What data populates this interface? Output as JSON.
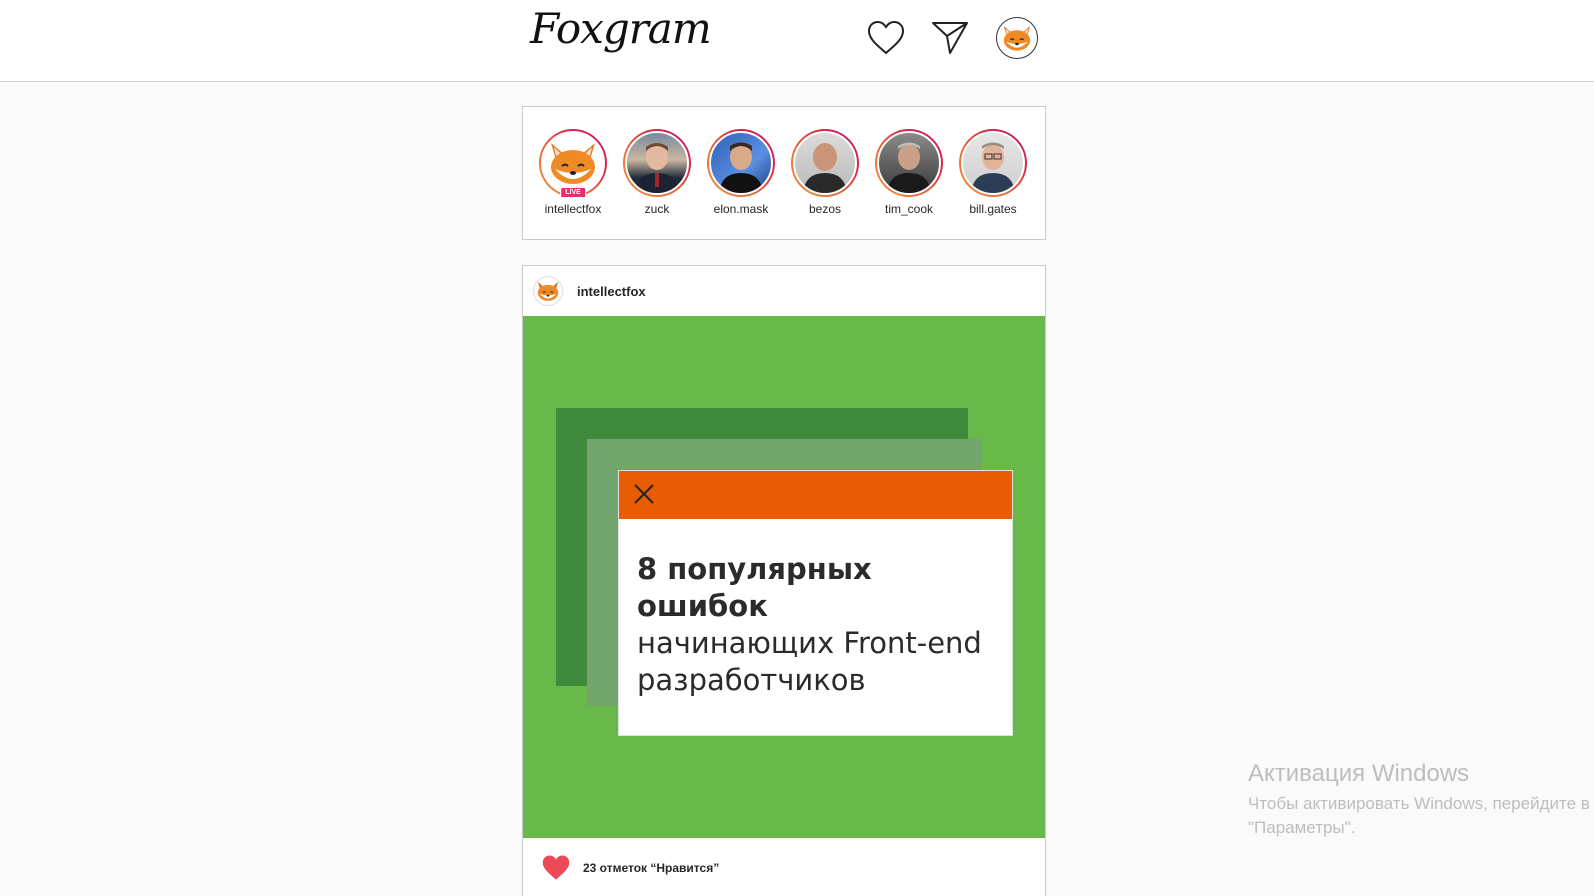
{
  "header": {
    "logo": "Foxgram",
    "icons": [
      "heart-icon",
      "send-icon",
      "profile-avatar"
    ]
  },
  "stories": [
    {
      "name": "intellectfox",
      "live_badge": "LIVE"
    },
    {
      "name": "zuck"
    },
    {
      "name": "elon.mask"
    },
    {
      "name": "bezos"
    },
    {
      "name": "tim_cook"
    },
    {
      "name": "bill.gates"
    }
  ],
  "post": {
    "username": "intellectfox",
    "image_text": {
      "bold_line1": "8 популярных",
      "bold_line2": "ошибок",
      "line3": "начинающих Front-end",
      "line4": "разработчиков"
    },
    "likes_text": "23 отметок “Нравится”"
  },
  "watermark": {
    "title": "Активация Windows",
    "line1": "Чтобы активировать Windows, перейдите в раздел",
    "line2": "\"Параметры\"."
  },
  "colors": {
    "image_bg": "#69b84a",
    "accent_orange": "#e85d04",
    "like_red": "#ed4956"
  }
}
